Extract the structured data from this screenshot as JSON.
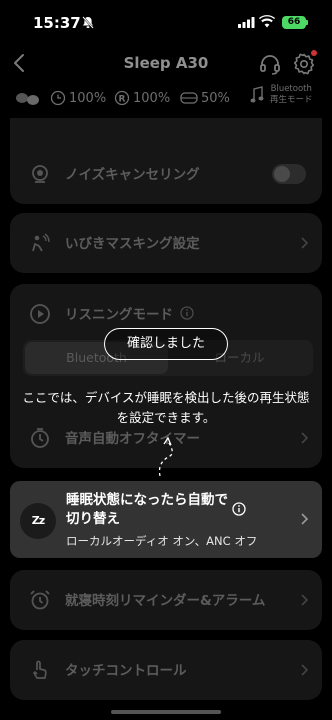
{
  "status_bar": {
    "time": "15:37",
    "battery": "66"
  },
  "header": {
    "title": "Sleep A30"
  },
  "battery_row": {
    "left": "100%",
    "right": "100%",
    "case": "50%",
    "mode_line1": "Bluetooth",
    "mode_line2": "再生モード"
  },
  "settings": {
    "noise_cancelling": "ノイズキャンセリング",
    "snore_masking": "いびきマスキング設定",
    "listening_mode": "リスニングモード",
    "mode_bluetooth": "Bluetooth",
    "mode_local": "ローカル",
    "auto_off_timer": "音声自動オフタイマー",
    "sleep_switch_title": "睡眠状態になったら自動で切り替え",
    "sleep_switch_sub": "ローカルオーディオ オン、ANC オフ",
    "bedtime_reminder": "就寝時刻リマインダー&アラーム",
    "touch_control": "タッチコントロール"
  },
  "overlay": {
    "confirm_button": "確認しました",
    "tip_line1": "ここでは、デバイスが睡眠を検出した後の再生状態",
    "tip_line2": "を設定できます。"
  },
  "colors": {
    "accent_green": "#4cd964",
    "badge_red": "#cc3333"
  }
}
